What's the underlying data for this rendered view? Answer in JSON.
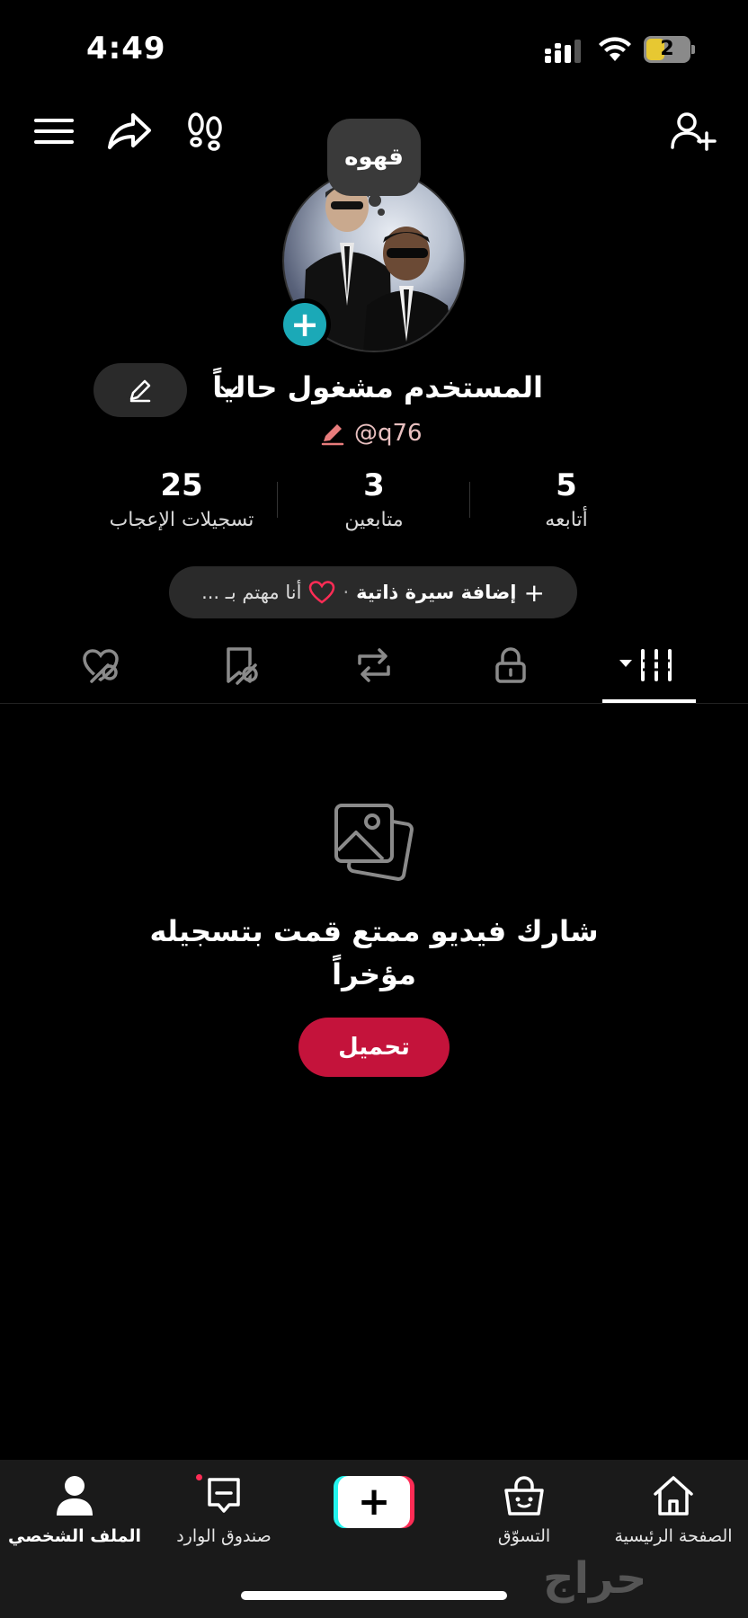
{
  "status_bar": {
    "time": "4:49",
    "battery_level": "2"
  },
  "header": {
    "menu_icon": "hamburger-icon",
    "share_icon": "share-icon",
    "footprint_icon": "footprint-icon",
    "add_friend_icon": "add-user-icon"
  },
  "profile": {
    "note": "قهوه",
    "display_name": "المستخدم مشغول حالياً",
    "username": "@q76",
    "stats": [
      {
        "value": "25",
        "label": "تسجيلات الإعجاب"
      },
      {
        "value": "3",
        "label": "متابعين"
      },
      {
        "value": "5",
        "label": "أتابعه"
      }
    ],
    "bio": {
      "add_label": "إضافة سيرة ذاتية",
      "separator": "·",
      "interest_label": "أنا مهتم بـ ..."
    }
  },
  "tabs": [
    {
      "name": "liked",
      "icon": "liked-hidden-icon"
    },
    {
      "name": "saved",
      "icon": "saved-hidden-icon"
    },
    {
      "name": "reposts",
      "icon": "repost-icon"
    },
    {
      "name": "private",
      "icon": "lock-icon"
    },
    {
      "name": "videos",
      "icon": "grid-icon",
      "selected": true
    }
  ],
  "empty_state": {
    "title": "شارك فيديو ممتع قمت بتسجيله مؤخراً",
    "upload_label": "تحميل"
  },
  "bottom_nav": {
    "profile": "الملف الشخصي",
    "inbox": "صندوق الوارد",
    "create": "+",
    "shop": "التسوّق",
    "home": "الصفحة الرئيسية"
  },
  "watermark": "حراج",
  "colors": {
    "background": "#000000",
    "accent_red": "#c4133b",
    "teal": "#1ba9b7",
    "nav_bg": "#1a1a1a"
  }
}
